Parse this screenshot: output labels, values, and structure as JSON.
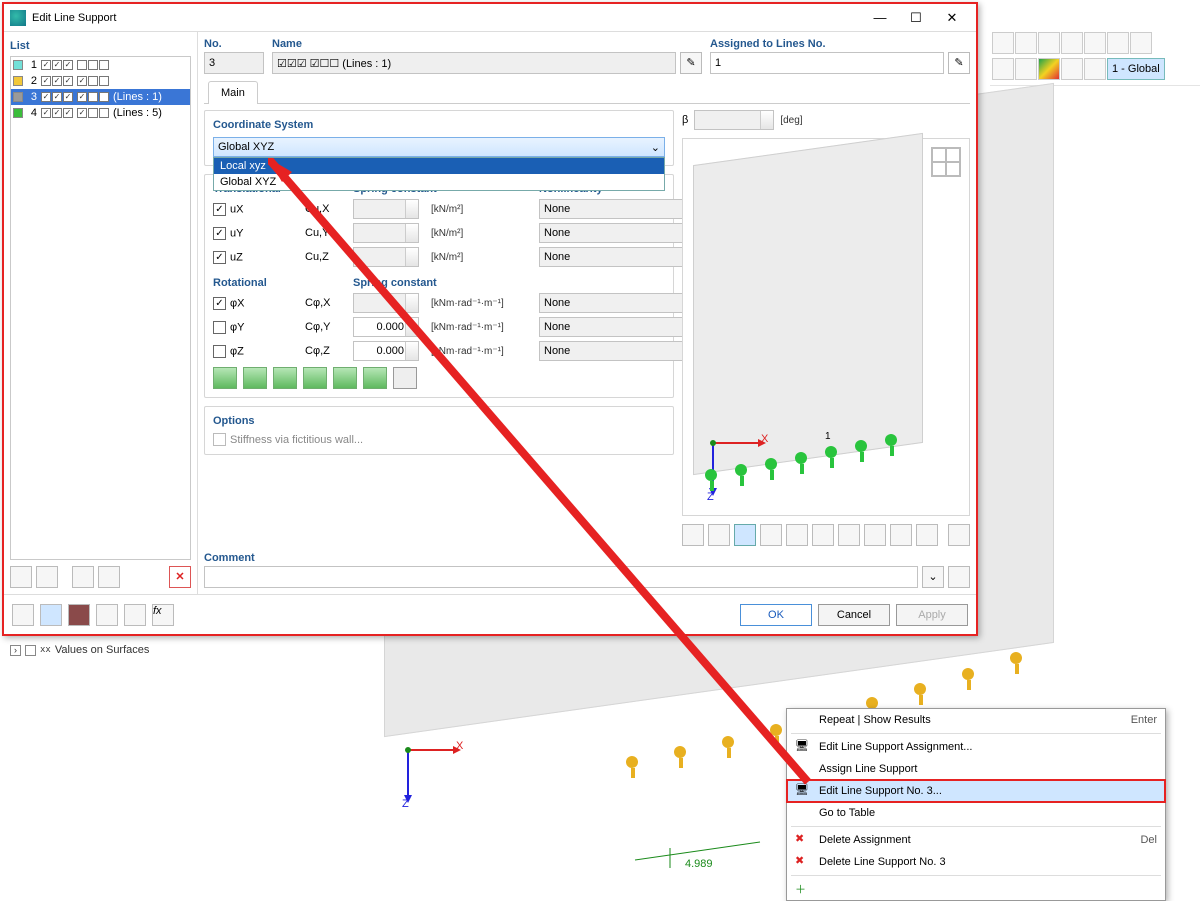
{
  "window": {
    "title": "Edit Line Support",
    "min": "—",
    "max": "☐",
    "close": "✕"
  },
  "list_header": "List",
  "list": [
    {
      "n": "1",
      "color": "#73e0d8",
      "sel": false,
      "suffix": ""
    },
    {
      "n": "2",
      "color": "#f2c83a",
      "sel": false,
      "suffix": ""
    },
    {
      "n": "3",
      "color": "#9a9a9a",
      "sel": true,
      "suffix": "(Lines : 1)"
    },
    {
      "n": "4",
      "color": "#3bbd3b",
      "sel": false,
      "suffix": "(Lines : 5)"
    }
  ],
  "no_header": "No.",
  "no_value": "3",
  "name_header": "Name",
  "name_value": "☑☑☑ ☑☐☐ (Lines : 1)",
  "assigned_header": "Assigned to Lines No.",
  "assigned_value": "1",
  "tabs": {
    "main": "Main"
  },
  "coord": {
    "label": "Coordinate System",
    "selected": "Global XYZ",
    "opts": [
      "Local xyz",
      "Global XYZ"
    ]
  },
  "beta": {
    "label": "β",
    "unit": "[deg]"
  },
  "spring": {
    "trans_h": "Translational",
    "spring_h": "Spring constant",
    "nonlin_h": "Nonlinearity",
    "rot_h": "Rotational",
    "rows_t": [
      {
        "ck": true,
        "lab": "uX",
        "c": "Cu,X",
        "unit": "[kN/m²]",
        "nl": "None"
      },
      {
        "ck": true,
        "lab": "uY",
        "c": "Cu,Y",
        "unit": "[kN/m²]",
        "nl": "None"
      },
      {
        "ck": true,
        "lab": "uZ",
        "c": "Cu,Z",
        "unit": "[kN/m²]",
        "nl": "None"
      }
    ],
    "rows_r": [
      {
        "ck": true,
        "lab": "φX",
        "c": "Cφ,X",
        "val": "",
        "unit": "[kNm·rad⁻¹·m⁻¹]",
        "nl": "None"
      },
      {
        "ck": false,
        "lab": "φY",
        "c": "Cφ,Y",
        "val": "0.000",
        "unit": "[kNm·rad⁻¹·m⁻¹]",
        "nl": "None"
      },
      {
        "ck": false,
        "lab": "φZ",
        "c": "Cφ,Z",
        "val": "0.000",
        "unit": "[kNm·rad⁻¹·m⁻¹]",
        "nl": "None"
      }
    ]
  },
  "options": {
    "label": "Options",
    "stiff": "Stiffness via fictitious wall..."
  },
  "comment": {
    "label": "Comment"
  },
  "buttons": {
    "ok": "OK",
    "cancel": "Cancel",
    "apply": "Apply"
  },
  "tree": {
    "item": "Values on Surfaces",
    "glyph": "xx"
  },
  "context": {
    "repeat": "Repeat | Show Results",
    "repeat_k": "Enter",
    "editassign": "Edit Line Support Assignment...",
    "assign": "Assign Line Support",
    "editno": "Edit Line Support No. 3...",
    "gotab": "Go to Table",
    "delassign": "Delete Assignment",
    "delassign_k": "Del",
    "delno": "Delete Line Support No. 3"
  },
  "axes": {
    "x": "X",
    "z": "Z"
  },
  "dim": "4.989",
  "support_label": "1",
  "toolbar_label": "1 - Global"
}
